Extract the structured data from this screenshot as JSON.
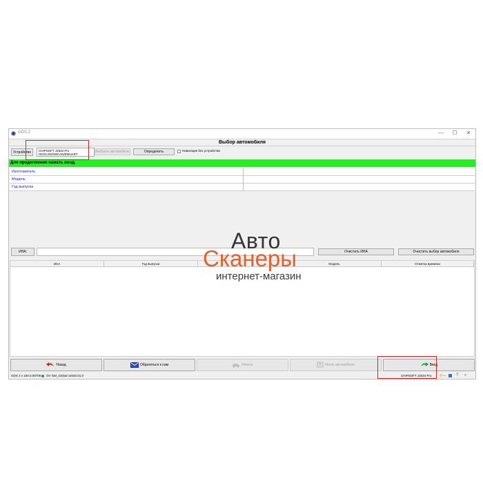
{
  "window": {
    "app_title": "GDS 2",
    "header": "Выбор автомобиля",
    "controls": {
      "minimize": "—",
      "maximize": "☐",
      "close": "✕"
    }
  },
  "device": {
    "label": "Устройство",
    "name": "CHIPSOFT J2534 Pro",
    "protocols": "ISO/CAN/SWCAN/EMUART",
    "select_vehicle": "Выбрать автомобиль",
    "detect": "Определить",
    "without_device": "Навигация без устройства"
  },
  "banner": "Для продолжения нажать ввод.",
  "properties": [
    {
      "label": "Изготовитель",
      "value": ""
    },
    {
      "label": "Модель",
      "value": ""
    },
    {
      "label": "Год выпуска",
      "value": ""
    }
  ],
  "vin": {
    "label": "ИНА:",
    "value": "",
    "clear_vin": "Очистить ИНА",
    "clear_vehicle": "Очистить выбор автомобиля"
  },
  "grid_columns": [
    "ИНА",
    "Год выпуска",
    "",
    "Модель",
    "Отметка времени"
  ],
  "nav": {
    "back": "Назад",
    "contact": "Обратиться к нам",
    "start": "Начать",
    "vehicle_menu": "Меню автомобиля",
    "enter": "Ввод"
  },
  "status": {
    "version": "GDS 2 v 100.0.00700",
    "global": "OV GM_Global v2020.01.0",
    "device": "CHIPSOFT J2534 Pro"
  },
  "watermark": {
    "line1": "Авто",
    "line2": "Сканеры",
    "line3": "интернет-магазин"
  },
  "colors": {
    "banner_green": "#21f21b",
    "highlight_red": "#d72020",
    "watermark_orange": "#e0632f",
    "link_blue": "#1a23c8"
  }
}
